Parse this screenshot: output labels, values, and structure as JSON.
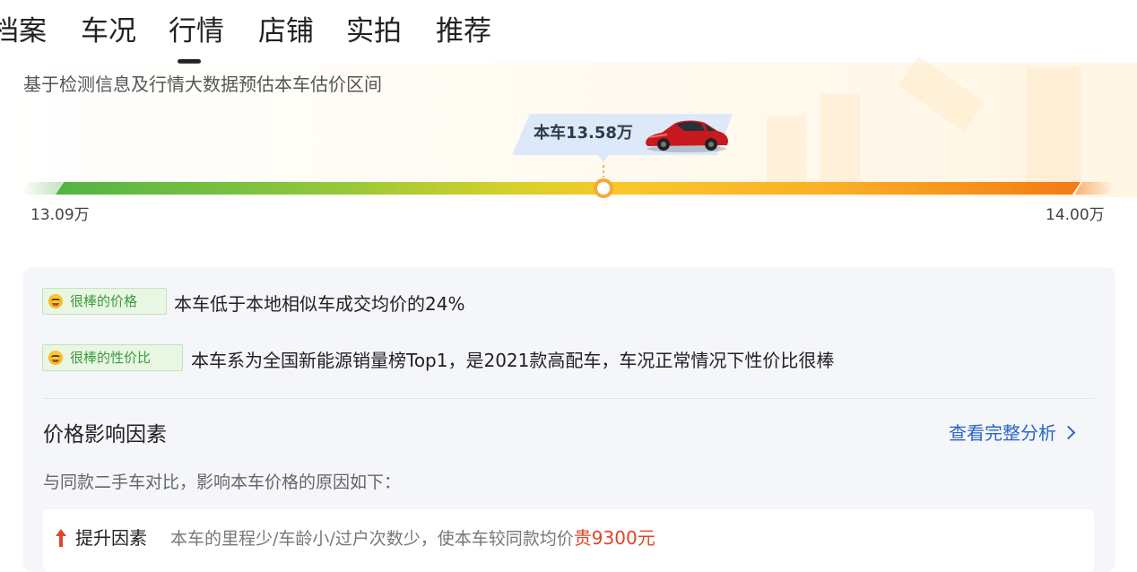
{
  "tabs": [
    "档案",
    "车况",
    "行情",
    "店铺",
    "实拍",
    "推荐"
  ],
  "active_tab": "行情",
  "valuation": {
    "subtitle": "基于检测信息及行情大数据预估本车估价区间",
    "current_label": "本车13.58万",
    "min": "13.09万",
    "max": "14.00万",
    "min_value": 13.09,
    "max_value": 14.0,
    "current_value": 13.58,
    "car_image": "red-sedan-icon"
  },
  "highlights": [
    {
      "tag": "很棒的价格",
      "text": "本车低于本地相似车成交均价的24%"
    },
    {
      "tag": "很棒的性价比",
      "text": "本车系为全国新能源销量榜Top1，是2021款高配车，车况正常情况下性价比很棒"
    }
  ],
  "factors": {
    "title": "价格影响因素",
    "link": "查看完整分析",
    "subtitle": "与同款二手车对比，影响本车价格的原因如下：",
    "items": [
      {
        "label": "提升因素",
        "text": "本车的里程少/车龄小/过户次数少，使本车较同款均价",
        "amount": "贵9300元",
        "direction": "up"
      }
    ]
  },
  "colors": {
    "bar_start": "#52b445",
    "bar_mid": "#f8c72a",
    "bar_end": "#f47a15",
    "tag_green": "#3a9c3f",
    "link_blue": "#2b64c8",
    "amount_red": "#e2452a"
  }
}
